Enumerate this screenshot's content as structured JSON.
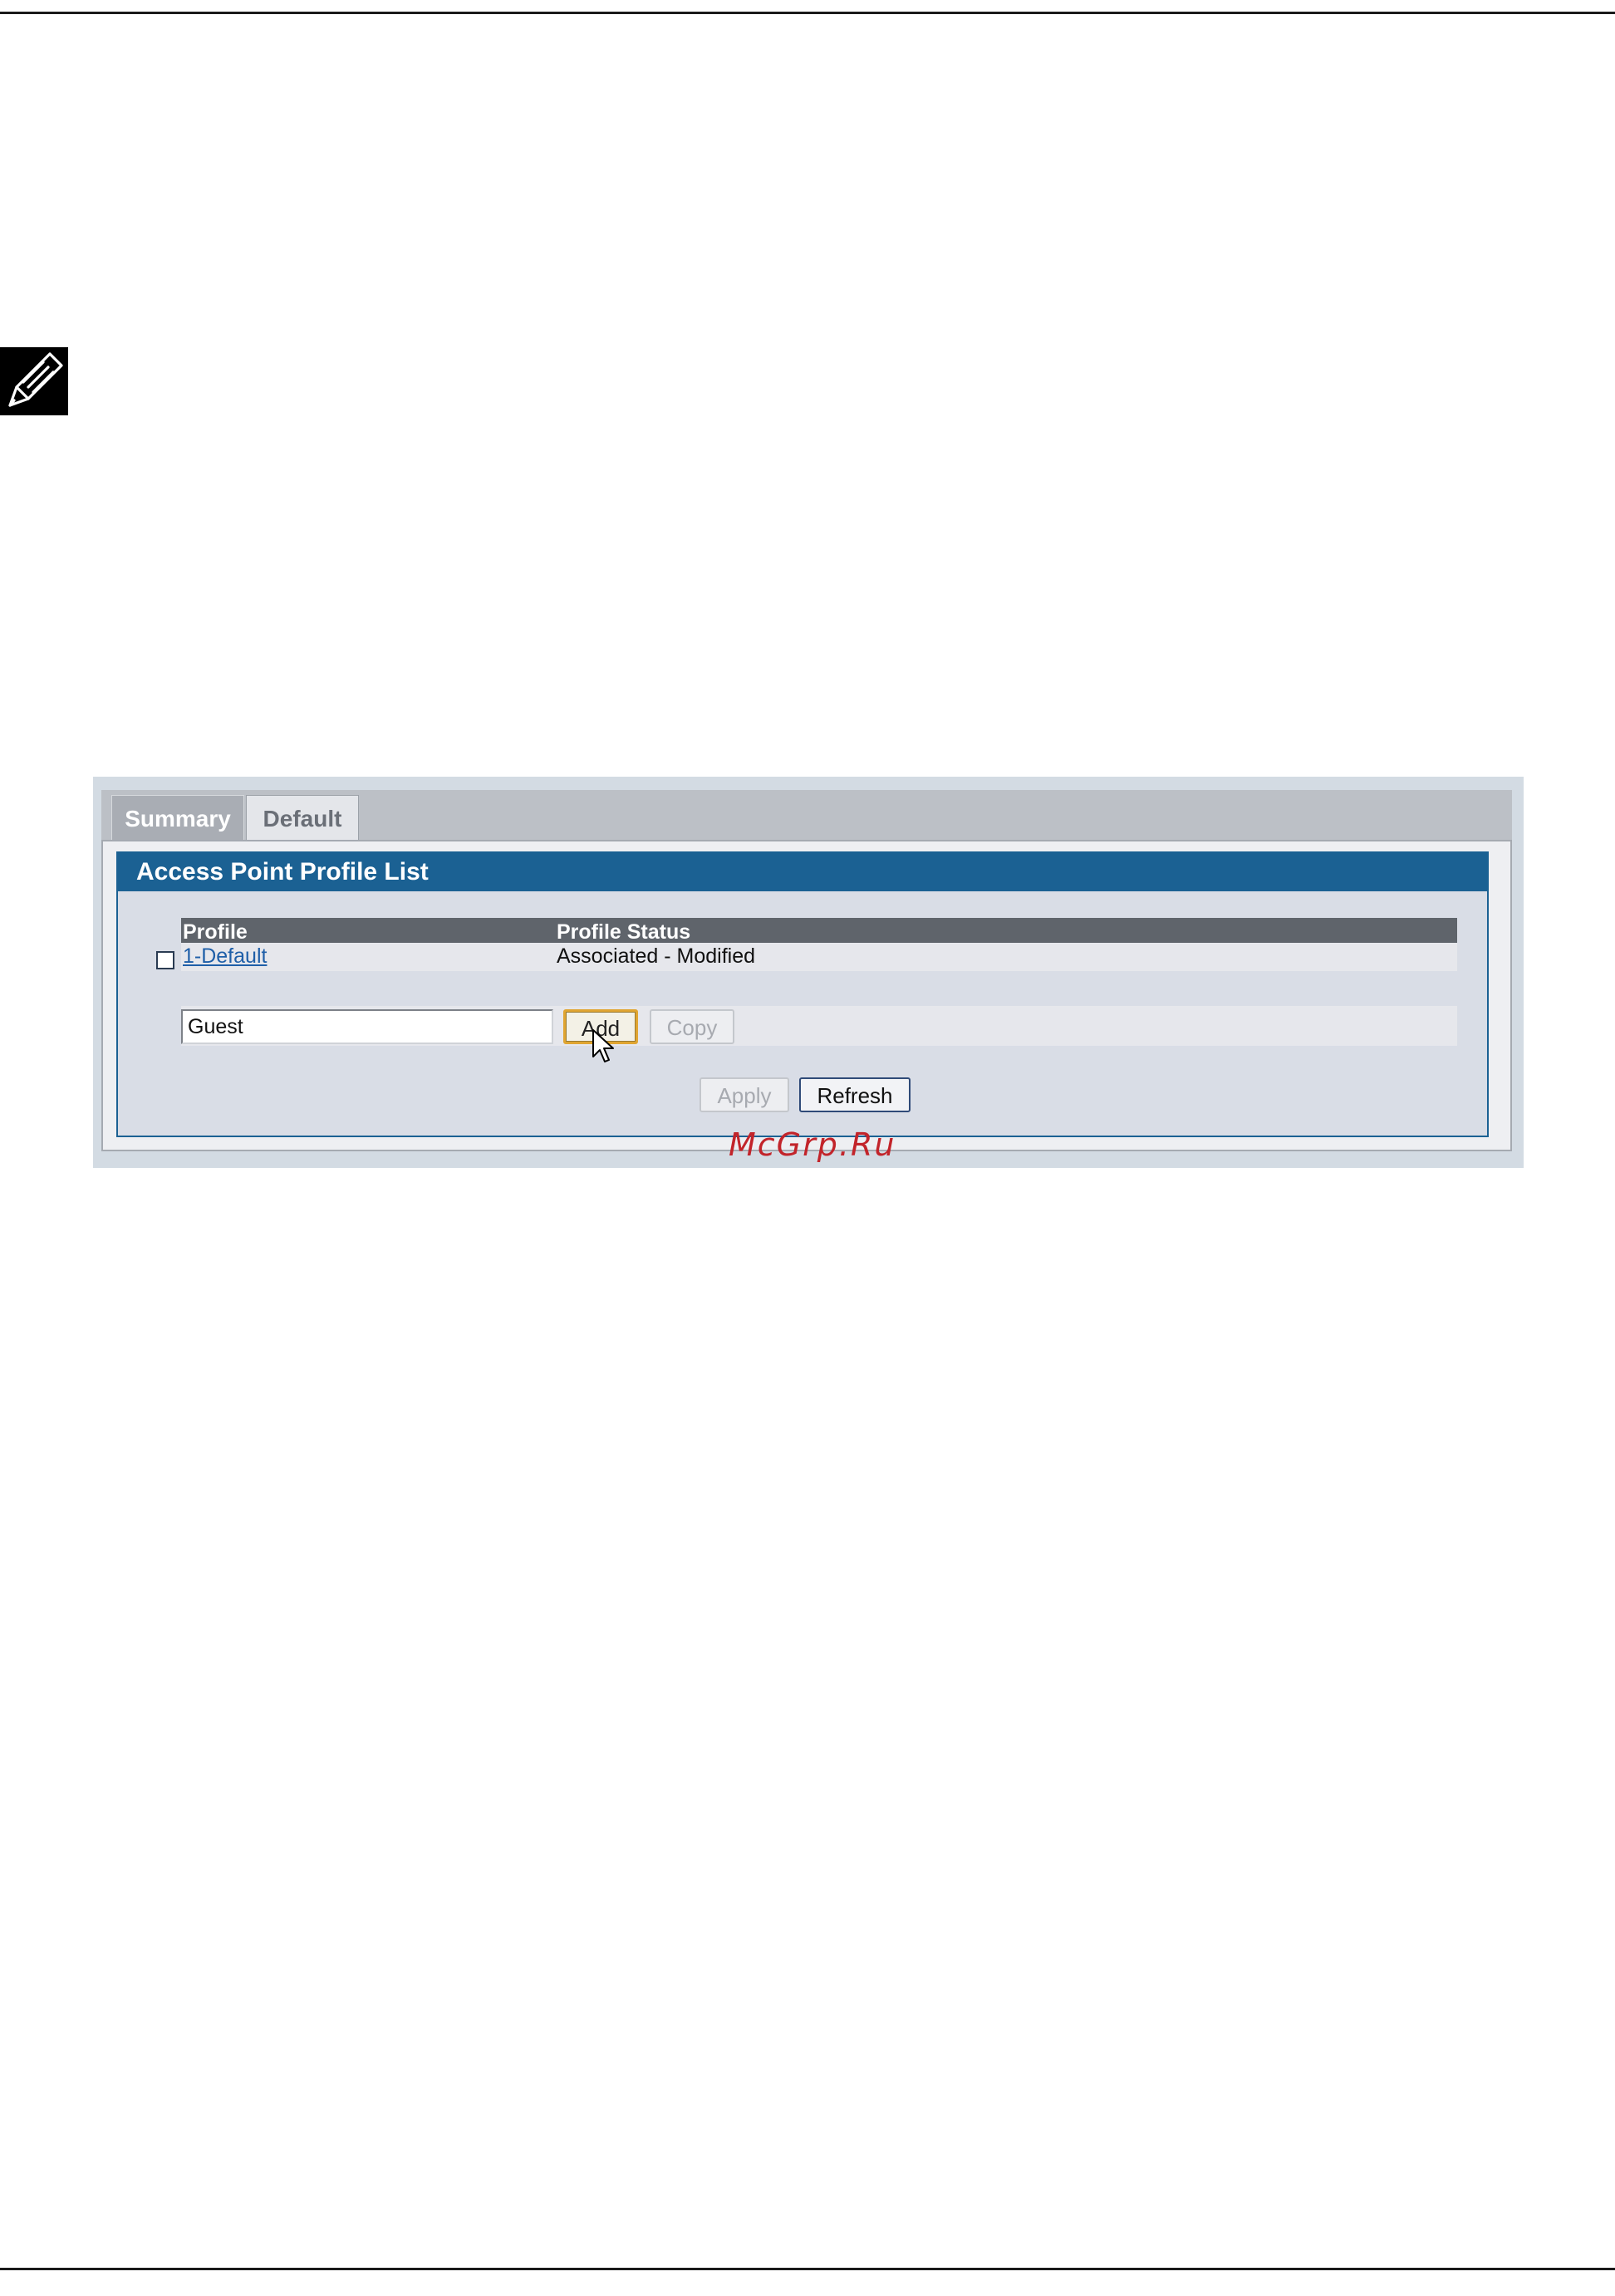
{
  "app": {
    "tabs": [
      {
        "label": "Summary",
        "active": true
      },
      {
        "label": "Default",
        "active": false
      }
    ],
    "panel_title": "Access Point Profile List",
    "table": {
      "headers": [
        "Profile",
        "Profile Status"
      ],
      "rows": [
        {
          "profile": "1-Default",
          "status": "Associated - Modified",
          "selected": false
        }
      ]
    },
    "new_profile": {
      "value": "Guest"
    },
    "buttons": {
      "add": "Add",
      "copy": "Copy",
      "apply": "Apply",
      "refresh": "Refresh"
    }
  },
  "watermark": "McGrp.Ru",
  "icons": {
    "note": "pencil-note-icon",
    "cursor": "mouse-pointer-icon"
  },
  "colors": {
    "header_blue": "#1b6193",
    "link_blue": "#1f5fa8",
    "watermark_red": "#c2242a",
    "add_focus": "#e0a531"
  }
}
